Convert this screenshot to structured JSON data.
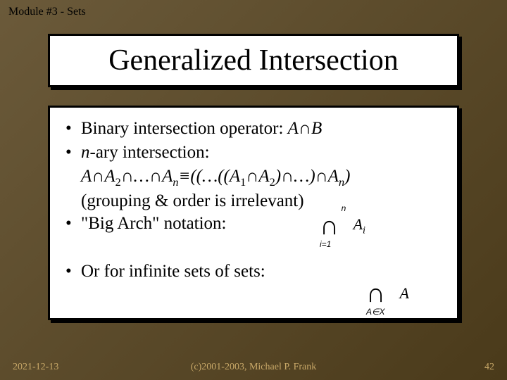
{
  "header": {
    "module": "Module #3 - Sets"
  },
  "title": "Generalized Intersection",
  "bullets": {
    "b1_pre": "Binary intersection operator: ",
    "b1_math": "A∩B",
    "b2_pre_n": "n",
    "b2_pre_rest": "-ary intersection:",
    "b2_line2_a": "A∩A",
    "b2_line2_b": "∩…∩A",
    "b2_line2_c": "≡((…((A",
    "b2_line2_d": "∩A",
    "b2_line2_e": ")∩…)∩A",
    "b2_line2_f": ")",
    "b2_line3": "(grouping & order is irrelevant)",
    "b3": "\"Big Arch\" notation:",
    "b4": "Or for infinite sets of sets:"
  },
  "subs": {
    "s1": "1",
    "s2": "2",
    "sn": "n"
  },
  "math1": {
    "sup": "n",
    "sub": "i=1",
    "term_a": "A",
    "term_i": "i"
  },
  "math2": {
    "sub": "A∈X",
    "term": "A"
  },
  "footer": {
    "date": "2021-12-13",
    "copyright": "(c)2001-2003, Michael P. Frank",
    "page": "42"
  }
}
